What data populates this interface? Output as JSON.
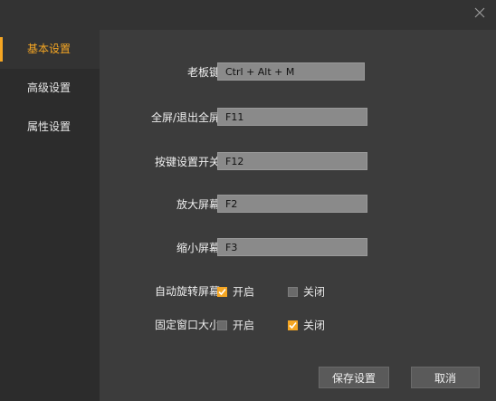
{
  "window": {
    "close_icon": "close-icon"
  },
  "sidebar": {
    "items": [
      {
        "label": "基本设置",
        "active": true
      },
      {
        "label": "高级设置",
        "active": false
      },
      {
        "label": "属性设置",
        "active": false
      }
    ]
  },
  "shortcuts": [
    {
      "label": "老板键",
      "value": "Ctrl + Alt + M"
    },
    {
      "label": "全屏/退出全屏",
      "value": "F11"
    },
    {
      "label": "按键设置开关",
      "value": "F12"
    },
    {
      "label": "放大屏幕",
      "value": "F2"
    },
    {
      "label": "缩小屏幕",
      "value": "F3"
    }
  ],
  "toggles": [
    {
      "label": "自动旋转屏幕",
      "on_label": "开启",
      "off_label": "关闭",
      "on_checked": true,
      "off_checked": false
    },
    {
      "label": "固定窗口大小",
      "on_label": "开启",
      "off_label": "关闭",
      "on_checked": false,
      "off_checked": true
    }
  ],
  "buttons": {
    "save": "保存设置",
    "cancel": "取消"
  },
  "colors": {
    "accent": "#f5a623",
    "sidebar_bg": "#2c2c2c",
    "content_bg": "#3c3c3c"
  }
}
